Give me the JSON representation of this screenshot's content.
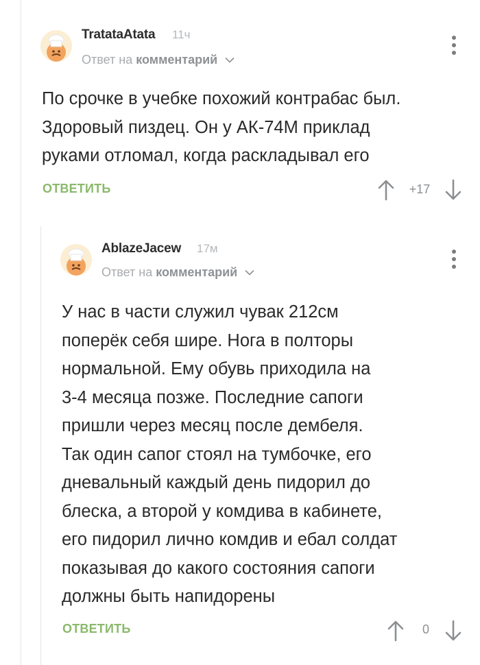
{
  "comments": [
    {
      "author": "TratataAtata",
      "time": "11ч",
      "reply_prefix": "Ответ на",
      "reply_link": "комментарий",
      "lines": [
        "По срочке в учебке похожий контрабас был.",
        "Здоровый пиздец. Он у АК-74М приклад",
        "руками отломал, когда раскладывал его"
      ],
      "reply_label": "ОТВЕТИТЬ",
      "rating": "+17"
    },
    {
      "author": "AblazeJacew",
      "time": "17м",
      "reply_prefix": "Ответ на",
      "reply_link": "комментарий",
      "lines": [
        "У нас в части служил чувак 212см",
        "поперёк себя шире. Нога в полторы",
        "нормальной. Ему обувь приходила на",
        "3-4 месяца позже. Последние сапоги",
        "пришли через месяц после дембеля.",
        "Так один сапог стоял на тумбочке, его",
        "дневальный каждый день пидорил до",
        "блеска, а второй у комдива в кабинете,",
        "его пидорил лично комдив и ебал солдат",
        "показывая до какого состояния сапоги",
        "должны быть напидорены"
      ],
      "reply_label": "ОТВЕТИТЬ",
      "rating": "0"
    }
  ],
  "icons": {
    "avatar": "chef-hat-avatar-icon",
    "menu": "kebab-menu-icon",
    "upvote": "arrow-up-icon",
    "downvote": "arrow-down-icon",
    "chevron": "chevron-down-icon"
  },
  "colors": {
    "reply_button": "#8ab96b",
    "muted_text": "#a8abae",
    "thread_line": "#e2e4e6",
    "avatar_bg": "#fbeed3"
  }
}
